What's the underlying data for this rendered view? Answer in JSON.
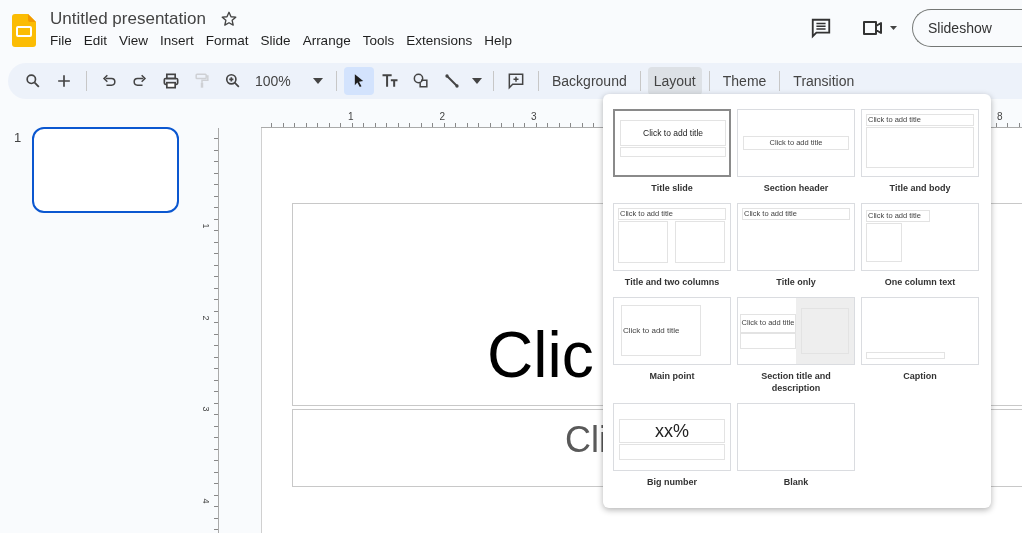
{
  "document": {
    "title": "Untitled presentation",
    "starred": false
  },
  "menu": [
    "File",
    "Edit",
    "View",
    "Insert",
    "Format",
    "Slide",
    "Arrange",
    "Tools",
    "Extensions",
    "Help"
  ],
  "slideshow_button": "Slideshow",
  "toolbar": [
    {
      "kind": "search",
      "selected": false
    },
    {
      "kind": "new-slide",
      "selected": false
    },
    {
      "kind": "separator"
    },
    {
      "kind": "undo",
      "selected": false
    },
    {
      "kind": "redo",
      "selected": false
    },
    {
      "kind": "print",
      "selected": false
    },
    {
      "kind": "paint-format",
      "selected": false,
      "disabled": true
    },
    {
      "kind": "zoom",
      "selected": false
    },
    {
      "kind": "zoom-level",
      "label": "100%"
    },
    {
      "kind": "separator"
    },
    {
      "kind": "select",
      "selected": true
    },
    {
      "kind": "text-box",
      "selected": false
    },
    {
      "kind": "shape",
      "selected": false
    },
    {
      "kind": "line",
      "selected": false
    },
    {
      "kind": "separator"
    },
    {
      "kind": "comment",
      "selected": false
    },
    {
      "kind": "separator"
    },
    {
      "kind": "text",
      "label": "Background",
      "selected": false
    },
    {
      "kind": "separator"
    },
    {
      "kind": "text",
      "label": "Layout",
      "selected": true
    },
    {
      "kind": "separator"
    },
    {
      "kind": "text",
      "label": "Theme",
      "selected": false
    },
    {
      "kind": "separator"
    },
    {
      "kind": "text",
      "label": "Transition",
      "selected": false
    }
  ],
  "filmstrip": [
    {
      "number": "1",
      "selected": true
    }
  ],
  "rulers": {
    "top_labels": [
      "1",
      "2",
      "3"
    ],
    "top_edge_label": "8",
    "side_labels": [
      "1",
      "2",
      "3",
      "4"
    ]
  },
  "slide": {
    "title": "Clic",
    "subtitle": "Cli"
  },
  "layout_menu": [
    {
      "kind": "title_slide",
      "label": "Title slide",
      "selected": true,
      "title": "Click to add title"
    },
    {
      "kind": "section_header",
      "label": "Section header",
      "selected": false,
      "title": "Click to add title"
    },
    {
      "kind": "title_and_body",
      "label": "Title and body",
      "selected": false,
      "title": "Click to add title"
    },
    {
      "kind": "two_columns",
      "label": "Title and two columns",
      "selected": false,
      "title": "Click to add title"
    },
    {
      "kind": "title_only",
      "label": "Title only",
      "selected": false,
      "title": "Click to add title"
    },
    {
      "kind": "one_column",
      "label": "One column text",
      "selected": false,
      "title": "Click to add title"
    },
    {
      "kind": "main_point",
      "label": "Main point",
      "selected": false,
      "title": "Click to add title"
    },
    {
      "kind": "section_desc",
      "label": "Section title and description",
      "selected": false,
      "title": "Click to add title"
    },
    {
      "kind": "caption",
      "label": "Caption",
      "selected": false
    },
    {
      "kind": "big_number",
      "label": "Big number",
      "selected": false,
      "title": "xx%"
    },
    {
      "kind": "blank",
      "label": "Blank",
      "selected": false
    }
  ]
}
